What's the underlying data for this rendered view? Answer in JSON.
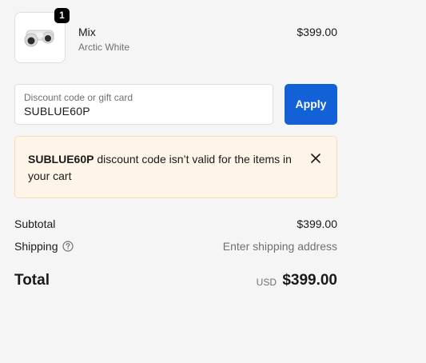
{
  "cart": {
    "item": {
      "image_alt": "product-image",
      "quantity": "1",
      "name": "Mix",
      "variant": "Arctic White",
      "price": "$399.00"
    }
  },
  "discount": {
    "label": "Discount code or gift card",
    "value": "SUBLUE60P",
    "apply_label": "Apply"
  },
  "error": {
    "code": "SUBLUE60P",
    "message": " discount code isn’t valid for the items in your cart"
  },
  "summary": {
    "subtotal_label": "Subtotal",
    "subtotal_value": "$399.00",
    "shipping_label": "Shipping",
    "shipping_value": "Enter shipping address",
    "total_label": "Total",
    "currency": "USD",
    "total_value": "$399.00"
  },
  "colors": {
    "background": "#f5f5f5",
    "accent": "#1261d6",
    "error_bg": "#fff4e8",
    "error_border": "#f6dcb8"
  }
}
